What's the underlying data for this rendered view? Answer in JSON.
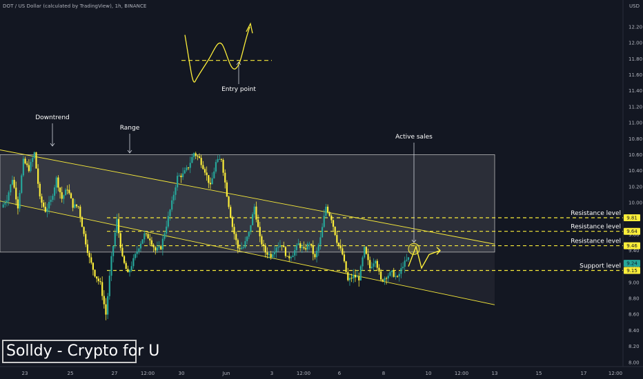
{
  "header": {
    "title": "DOT / US Dollar (calculated by TradingView), 1h, BINANCE",
    "currency": "USD"
  },
  "brand": {
    "label": "Solldy - Crypto for U"
  },
  "chart_data": {
    "type": "candlestick",
    "y_ticks": [
      "12.20",
      "12.00",
      "11.80",
      "11.60",
      "11.40",
      "11.20",
      "11.00",
      "10.80",
      "10.60",
      "10.40",
      "10.20",
      "10.00",
      "9.80",
      "9.60",
      "9.40",
      "9.20",
      "9.00",
      "8.80",
      "8.60",
      "8.40",
      "8.20",
      "8.00"
    ],
    "x_ticks": [
      "23",
      "25",
      "27",
      "12:00",
      "30",
      "Jun",
      "3",
      "12:00",
      "6",
      "8",
      "10",
      "12:00",
      "13",
      "15",
      "17",
      "12:00"
    ],
    "annotations": [
      "Downtrend",
      "Range",
      "Entry point",
      "Active sales"
    ],
    "levels": [
      {
        "label": "Resistance level",
        "value": 9.81,
        "tag": "9.81"
      },
      {
        "label": "Resistance level",
        "value": 9.64,
        "tag": "9.64"
      },
      {
        "label": "Resistance level",
        "value": 9.46,
        "tag": "9.46"
      },
      {
        "label": "Support level",
        "value": 9.15,
        "tag": "9.15"
      }
    ],
    "current_price": {
      "value": 9.24,
      "tag": "9.24"
    },
    "range_box": {
      "low": 9.38,
      "high": 10.6
    },
    "channel": {
      "upper_start": 10.66,
      "upper_end": 9.48,
      "lower_start": 10.02,
      "lower_end": 8.72
    },
    "price_path": [
      9.94,
      10.05,
      10.3,
      9.95,
      10.52,
      10.42,
      10.62,
      10.05,
      9.9,
      10.02,
      10.3,
      10.05,
      10.18,
      9.96,
      9.95,
      9.6,
      9.3,
      9.1,
      8.98,
      8.6,
      9.3,
      9.78,
      9.3,
      9.1,
      9.28,
      9.45,
      9.6,
      9.55,
      9.4,
      9.44,
      9.72,
      10.0,
      10.32,
      10.35,
      10.45,
      10.62,
      10.55,
      10.4,
      10.2,
      10.5,
      10.55,
      10.1,
      9.7,
      9.43,
      9.44,
      9.62,
      9.95,
      9.55,
      9.38,
      9.34,
      9.45,
      9.48,
      9.3,
      9.36,
      9.48,
      9.4,
      9.5,
      9.3,
      9.55,
      9.95,
      9.8,
      9.52,
      9.35,
      9.02,
      9.08,
      9.05,
      9.42,
      9.18,
      9.3,
      9.02,
      9.08,
      9.12,
      9.05,
      9.22,
      9.3
    ],
    "projection": [
      9.2,
      9.45,
      9.18,
      9.35,
      9.4
    ],
    "entry_sketch": [
      12.1,
      11.62,
      11.55,
      11.98,
      11.7,
      12.1,
      12.22
    ],
    "entry_level": 11.78,
    "colors": {
      "bullish": "#26a69a",
      "bearish": "#fcee3a",
      "level": "#fcee3a",
      "background": "#131722",
      "tag": "#fcee3a",
      "current_tag": "#26a69a"
    }
  }
}
